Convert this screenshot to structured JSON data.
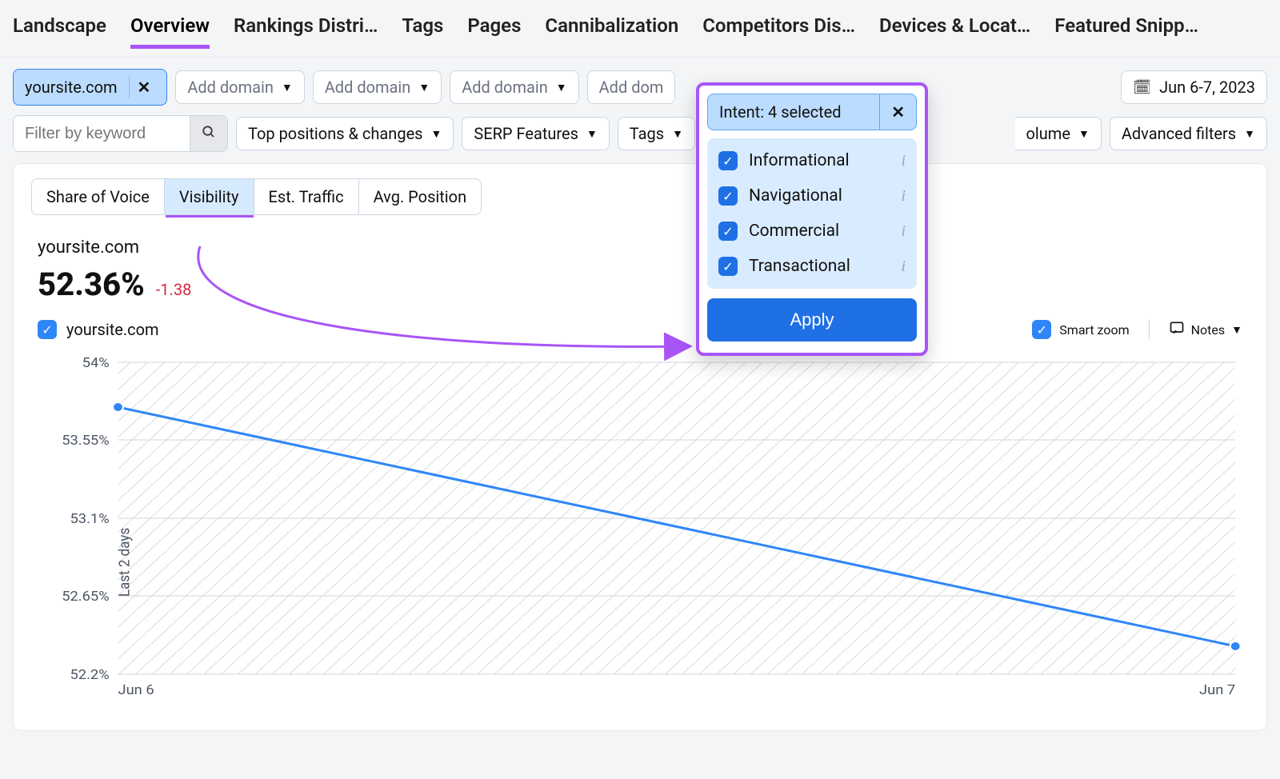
{
  "tabs": {
    "items": [
      "Landscape",
      "Overview",
      "Rankings Distri…",
      "Tags",
      "Pages",
      "Cannibalization",
      "Competitors Dis…",
      "Devices & Locat…",
      "Featured Snipp…"
    ],
    "active_index": 1
  },
  "filters": {
    "selected_domain": "yoursite.com",
    "add_domain_label": "Add domain",
    "add_domain_trunc": "Add dom",
    "date_range": "Jun 6-7, 2023",
    "keyword_placeholder": "Filter by keyword",
    "top_positions": "Top positions & changes",
    "serp_features": "SERP Features",
    "tags": "Tags",
    "volume_fragment": "olume",
    "advanced": "Advanced filters"
  },
  "intent": {
    "header": "Intent: 4 selected",
    "options": [
      "Informational",
      "Navigational",
      "Commercial",
      "Transactional"
    ],
    "apply": "Apply"
  },
  "metric_tabs": {
    "items": [
      "Share of Voice",
      "Visibility",
      "Est. Traffic",
      "Avg. Position"
    ],
    "active_index": 1
  },
  "summary": {
    "site": "yoursite.com",
    "value": "52.36%",
    "delta": "-1.38"
  },
  "legend": {
    "series0": "yoursite.com",
    "smart_zoom": "Smart zoom",
    "notes": "Notes"
  },
  "chart_data": {
    "type": "line",
    "title": "",
    "xlabel": "",
    "ylabel": "Last 2 days",
    "ylim": [
      52.2,
      54
    ],
    "y_ticks": [
      54,
      53.55,
      53.1,
      52.65,
      52.2
    ],
    "y_tick_labels_raw": [
      "54%",
      "53.55%",
      "53.1%",
      "52.65%",
      "52.2%"
    ],
    "categories": [
      "Jun 6",
      "Jun 7"
    ],
    "series": [
      {
        "name": "yoursite.com",
        "values": [
          53.74,
          52.36
        ]
      }
    ]
  },
  "colors": {
    "accent_purple": "#a855f7",
    "brand_blue": "#2f86f6",
    "chip_blue_bg": "#bcdcff",
    "danger": "#d6293e"
  }
}
